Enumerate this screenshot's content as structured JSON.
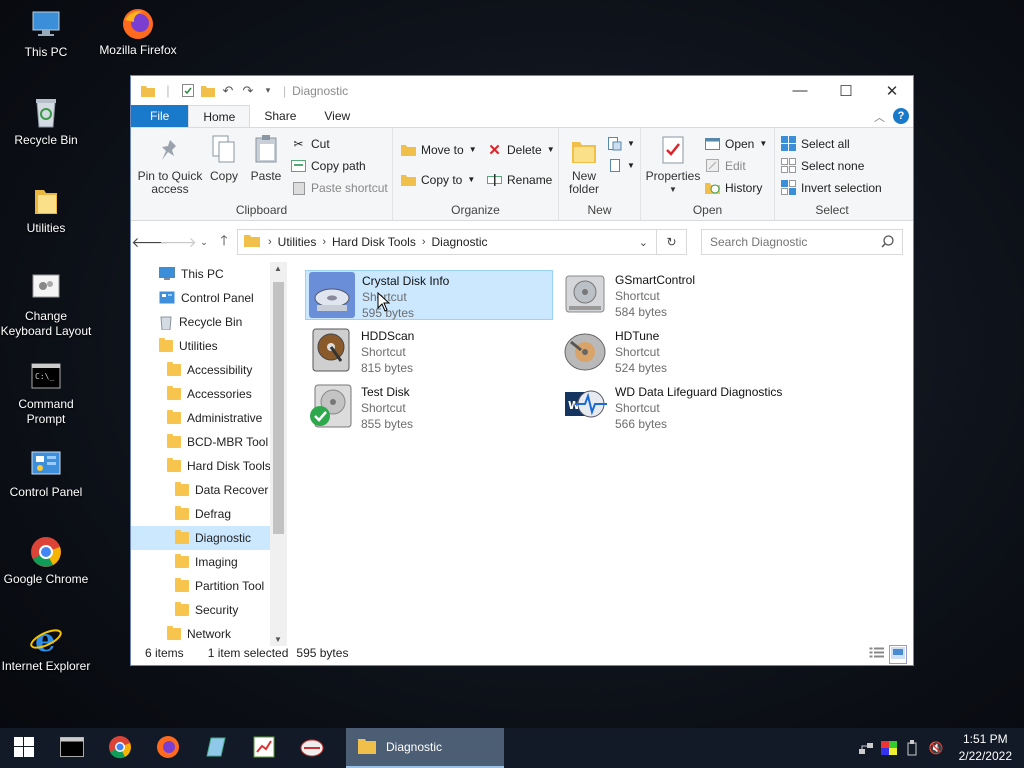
{
  "desktop": {
    "icons": [
      "This PC",
      "Mozilla Firefox",
      "Recycle Bin",
      "Utilities",
      "Change Keyboard Layout",
      "Command Prompt",
      "Control Panel",
      "Google Chrome",
      "Internet Explorer"
    ]
  },
  "window": {
    "title": "Diagnostic",
    "tabs": [
      "File",
      "Home",
      "Share",
      "View"
    ],
    "ribbon": {
      "clipboard": {
        "label": "Clipboard",
        "pin": "Pin to Quick access",
        "copy": "Copy",
        "paste": "Paste",
        "cut": "Cut",
        "copy_path": "Copy path",
        "paste_shortcut": "Paste shortcut"
      },
      "organize": {
        "label": "Organize",
        "move_to": "Move to",
        "copy_to": "Copy to",
        "delete": "Delete",
        "rename": "Rename"
      },
      "new": {
        "label": "New",
        "new_folder": "New folder"
      },
      "open": {
        "label": "Open",
        "properties": "Properties",
        "open": "Open",
        "edit": "Edit",
        "history": "History"
      },
      "select": {
        "label": "Select",
        "select_all": "Select all",
        "select_none": "Select none",
        "invert": "Invert selection"
      }
    },
    "address": {
      "crumbs": [
        "Utilities",
        "Hard Disk Tools",
        "Diagnostic"
      ]
    },
    "search": {
      "placeholder": "Search Diagnostic"
    },
    "nav_pane": [
      {
        "label": "This PC",
        "indent": 1,
        "icon": "pc-icon"
      },
      {
        "label": "Control Panel",
        "indent": 1,
        "icon": "control-panel-icon"
      },
      {
        "label": "Recycle Bin",
        "indent": 1,
        "icon": "recycle-bin-icon"
      },
      {
        "label": "Utilities",
        "indent": 1,
        "icon": "folder-icon"
      },
      {
        "label": "Accessibility",
        "indent": 2,
        "icon": "folder-icon"
      },
      {
        "label": "Accessories",
        "indent": 2,
        "icon": "folder-icon"
      },
      {
        "label": "Administrative",
        "indent": 2,
        "icon": "folder-icon"
      },
      {
        "label": "BCD-MBR Tool",
        "indent": 2,
        "icon": "folder-icon"
      },
      {
        "label": "Hard Disk Tools",
        "indent": 2,
        "icon": "folder-icon"
      },
      {
        "label": "Data Recover",
        "indent": 3,
        "icon": "folder-icon"
      },
      {
        "label": "Defrag",
        "indent": 3,
        "icon": "folder-icon"
      },
      {
        "label": "Diagnostic",
        "indent": 3,
        "icon": "folder-icon",
        "selected": true
      },
      {
        "label": "Imaging",
        "indent": 3,
        "icon": "folder-icon"
      },
      {
        "label": "Partition Tool",
        "indent": 3,
        "icon": "folder-icon"
      },
      {
        "label": "Security",
        "indent": 3,
        "icon": "folder-icon"
      },
      {
        "label": "Network",
        "indent": 2,
        "icon": "folder-icon"
      }
    ],
    "files": [
      {
        "name": "Crystal Disk Info",
        "type": "Shortcut",
        "size": "595 bytes",
        "selected": true,
        "icon": "crystal-disk-info-icon"
      },
      {
        "name": "GSmartControl",
        "type": "Shortcut",
        "size": "584 bytes",
        "icon": "gsmartcontrol-icon"
      },
      {
        "name": "HDDScan",
        "type": "Shortcut",
        "size": "815 bytes",
        "icon": "hddscan-icon"
      },
      {
        "name": "HDTune",
        "type": "Shortcut",
        "size": "524 bytes",
        "icon": "hdtune-icon"
      },
      {
        "name": "Test Disk",
        "type": "Shortcut",
        "size": "855 bytes",
        "icon": "testdisk-icon"
      },
      {
        "name": "WD Data Lifeguard Diagnostics",
        "type": "Shortcut",
        "size": "566 bytes",
        "icon": "wd-lifeguard-icon"
      }
    ],
    "status": {
      "count": "6 items",
      "selected": "1 item selected",
      "size": "595 bytes"
    }
  },
  "taskbar": {
    "active_window": "Diagnostic",
    "time": "1:51 PM",
    "date": "2/22/2022"
  }
}
